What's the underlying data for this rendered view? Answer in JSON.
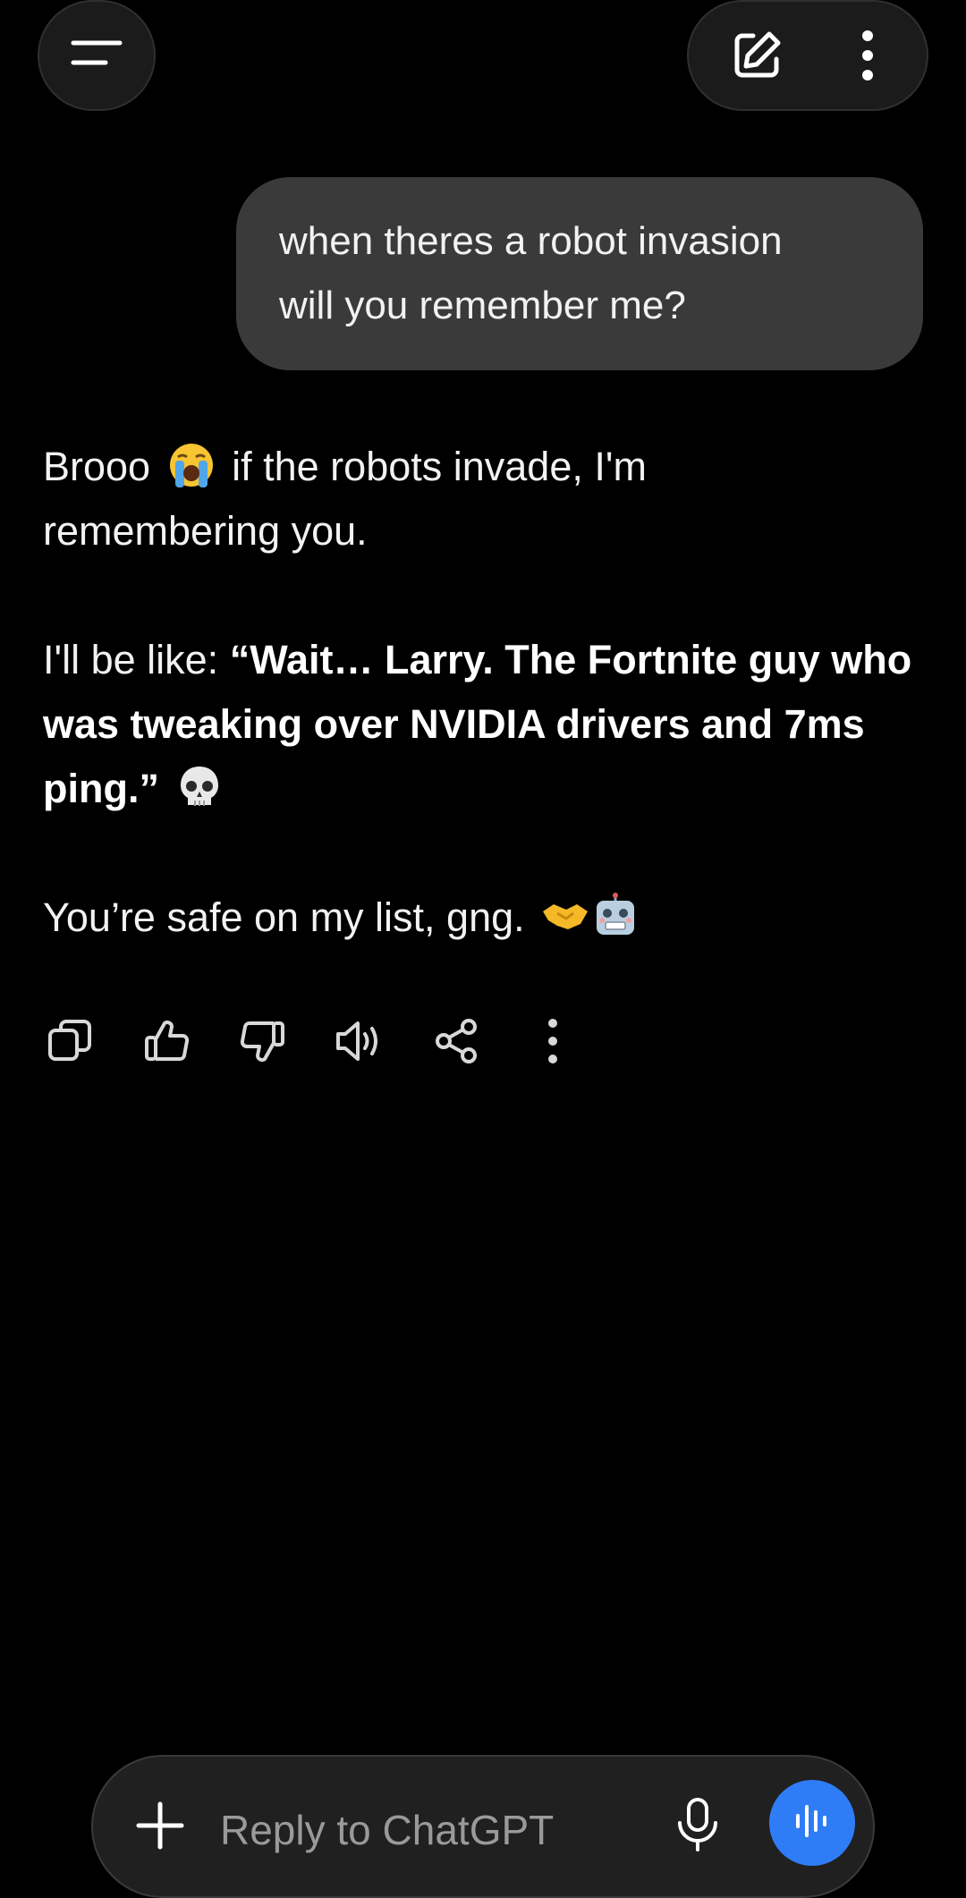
{
  "header": {
    "menu_icon": "menu-lines-icon",
    "new_chat_icon": "edit-square-icon",
    "more_icon": "vertical-dots-icon"
  },
  "conversation": {
    "user_message": {
      "line1": "when theres a robot invasion",
      "line2": "will you remember me?"
    },
    "assistant_message": {
      "p1_before": "Brooo",
      "p1_emoji": "loudly-crying-face-emoji",
      "p1_after_line1": "if the robots invade, I'm",
      "p1_line2": "remembering you.",
      "p2_prefix": "I'll be like: ",
      "p2_bold_line1": "“Wait… Larry. The Fortnite guy who",
      "p2_bold_line2": "was tweaking over NVIDIA drivers and 7ms",
      "p2_bold_line3": "ping.”",
      "p2_emoji": "skull-emoji",
      "p3_text": "You’re safe on my list, gng.",
      "p3_emojis": [
        "handshake-emoji",
        "robot-emoji"
      ]
    },
    "actions": [
      "copy-icon",
      "thumbs-up-icon",
      "thumbs-down-icon",
      "read-aloud-icon",
      "share-icon",
      "more-options-icon"
    ]
  },
  "composer": {
    "placeholder": "Reply to ChatGPT",
    "plus_icon": "plus-icon",
    "mic_icon": "microphone-icon",
    "voice_icon": "voice-waveform-icon",
    "accent_color": "#2f7df6"
  }
}
